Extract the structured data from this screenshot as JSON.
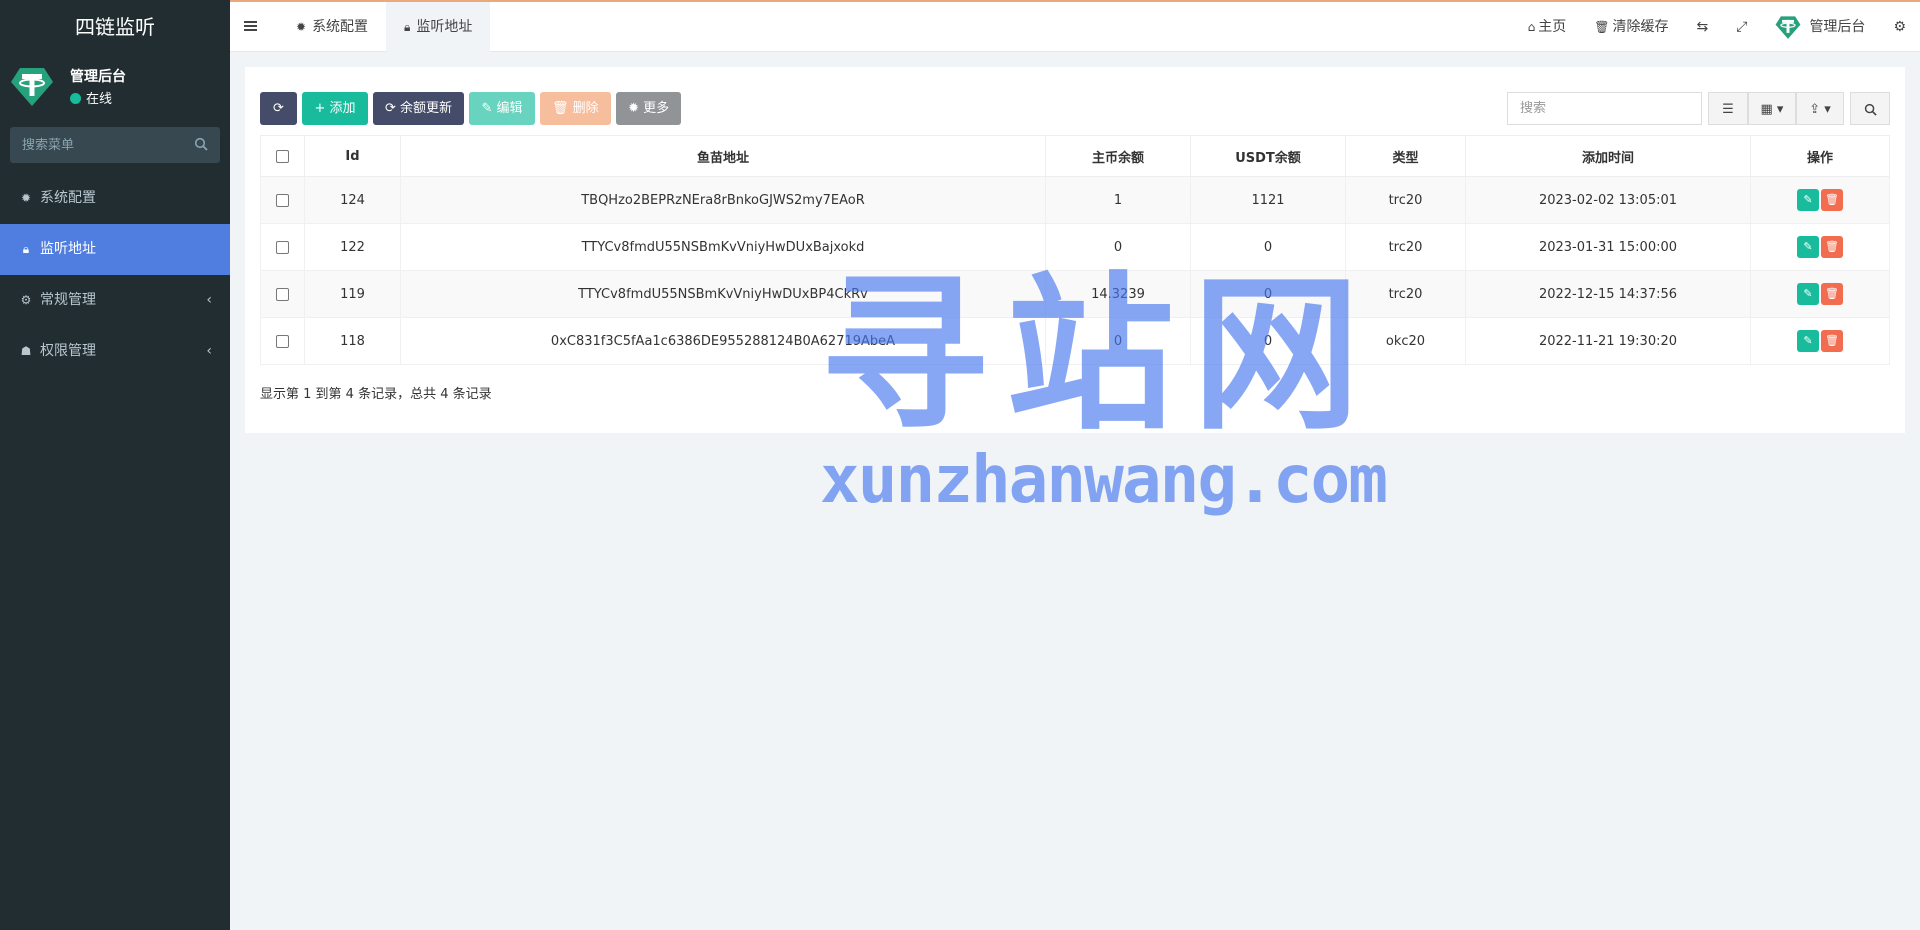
{
  "sidebar": {
    "brand": "四链监听",
    "user": {
      "name": "管理后台",
      "status": "在线"
    },
    "search_placeholder": "搜索菜单",
    "items": [
      {
        "label": "系统配置",
        "icon": "gear-icon",
        "active": false,
        "has_children": false
      },
      {
        "label": "监听地址",
        "icon": "lock-icon",
        "active": true,
        "has_children": false
      },
      {
        "label": "常规管理",
        "icon": "cogs-icon",
        "active": false,
        "has_children": true
      },
      {
        "label": "权限管理",
        "icon": "group-icon",
        "active": false,
        "has_children": true
      }
    ]
  },
  "topbar": {
    "tabs": [
      {
        "label": "系统配置",
        "icon": "gear-icon"
      },
      {
        "label": "监听地址",
        "icon": "lock-icon"
      }
    ],
    "links": {
      "home": "主页",
      "clear_cache": "清除缓存",
      "admin": "管理后台"
    }
  },
  "toolbar": {
    "add": "添加",
    "balance_update": "余额更新",
    "edit": "编辑",
    "delete": "删除",
    "more": "更多",
    "search_placeholder": "搜索"
  },
  "table": {
    "columns": [
      "Id",
      "鱼苗地址",
      "主币余额",
      "USDT余额",
      "类型",
      "添加时间",
      "操作"
    ],
    "rows": [
      {
        "id": "124",
        "address": "TBQHzo2BEPRzNEra8rBnkoGJWS2my7EAoR",
        "main_balance": "1",
        "usdt_balance": "1121",
        "type": "trc20",
        "time": "2023-02-02 13:05:01"
      },
      {
        "id": "122",
        "address": "TTYCv8fmdU55NSBmKvVniyHwDUxBajxokd",
        "main_balance": "0",
        "usdt_balance": "0",
        "type": "trc20",
        "time": "2023-01-31 15:00:00"
      },
      {
        "id": "119",
        "address": "TTYCv8fmdU55NSBmKvVniyHwDUxBP4CkRv",
        "main_balance": "14.3239",
        "usdt_balance": "0",
        "type": "trc20",
        "time": "2022-12-15 14:37:56"
      },
      {
        "id": "118",
        "address": "0xC831f3C5fAa1c6386DE955288124B0A62719AbeA",
        "main_balance": "0",
        "usdt_balance": "0",
        "type": "okc20",
        "time": "2022-11-21 19:30:20"
      }
    ],
    "pager_info": "显示第 1 到第 4 条记录，总共 4 条记录"
  },
  "watermark": {
    "big": "寻站网",
    "small": "xunzhanwang.com"
  },
  "colors": {
    "sidebar_bg": "#222d32",
    "active_item": "#4f7ee0",
    "success": "#18bc9c",
    "primary_dark": "#444c69",
    "orange_type": "#f08a47"
  }
}
